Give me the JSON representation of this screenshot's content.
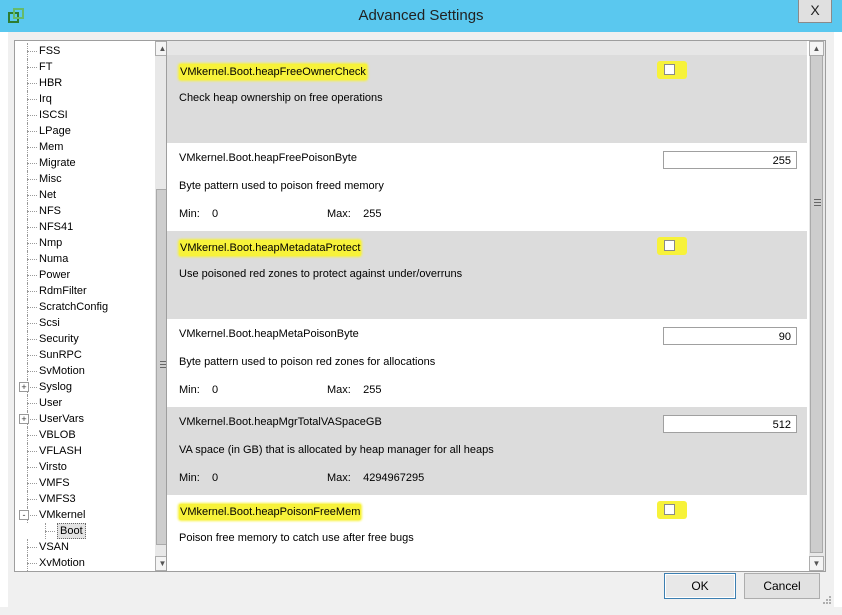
{
  "window": {
    "title": "Advanced Settings",
    "close_glyph": "X",
    "app_icon": "vsphere-logo-icon"
  },
  "tree": {
    "items": [
      {
        "label": "FSS"
      },
      {
        "label": "FT"
      },
      {
        "label": "HBR"
      },
      {
        "label": "Irq"
      },
      {
        "label": "ISCSI"
      },
      {
        "label": "LPage"
      },
      {
        "label": "Mem"
      },
      {
        "label": "Migrate"
      },
      {
        "label": "Misc"
      },
      {
        "label": "Net"
      },
      {
        "label": "NFS"
      },
      {
        "label": "NFS41"
      },
      {
        "label": "Nmp"
      },
      {
        "label": "Numa"
      },
      {
        "label": "Power"
      },
      {
        "label": "RdmFilter"
      },
      {
        "label": "ScratchConfig"
      },
      {
        "label": "Scsi"
      },
      {
        "label": "Security"
      },
      {
        "label": "SunRPC"
      },
      {
        "label": "SvMotion"
      },
      {
        "label": "Syslog",
        "expander": "+"
      },
      {
        "label": "User"
      },
      {
        "label": "UserVars",
        "expander": "+"
      },
      {
        "label": "VBLOB"
      },
      {
        "label": "VFLASH"
      },
      {
        "label": "Virsto"
      },
      {
        "label": "VMFS"
      },
      {
        "label": "VMFS3"
      },
      {
        "label": "VMkernel",
        "expander": "-"
      },
      {
        "label": "Boot",
        "child": true,
        "selected": true
      },
      {
        "label": "VSAN"
      },
      {
        "label": "XvMotion"
      }
    ]
  },
  "settings": [
    {
      "name": "VMkernel.Boot.heapFreeOwnerCheck",
      "highlighted": true,
      "description": "Check heap ownership on free operations",
      "type": "checkbox",
      "checked": false
    },
    {
      "name": "VMkernel.Boot.heapFreePoisonByte",
      "description": "Byte pattern used to poison freed memory",
      "type": "number",
      "value": "255",
      "min_label": "Min:",
      "min": "0",
      "max_label": "Max:",
      "max": "255"
    },
    {
      "name": "VMkernel.Boot.heapMetadataProtect",
      "highlighted": true,
      "description": "Use poisoned red zones to protect against under/overruns",
      "type": "checkbox",
      "checked": false
    },
    {
      "name": "VMkernel.Boot.heapMetaPoisonByte",
      "description": "Byte pattern used to poison red zones for allocations",
      "type": "number",
      "value": "90",
      "min_label": "Min:",
      "min": "0",
      "max_label": "Max:",
      "max": "255"
    },
    {
      "name": "VMkernel.Boot.heapMgrTotalVASpaceGB",
      "description": "VA space (in GB) that is allocated by heap manager for all heaps",
      "type": "number",
      "value": "512",
      "min_label": "Min:",
      "min": "0",
      "max_label": "Max:",
      "max": "4294967295"
    },
    {
      "name": "VMkernel.Boot.heapPoisonFreeMem",
      "highlighted": true,
      "description": "Poison free memory to catch use after free bugs",
      "type": "checkbox",
      "checked": false
    }
  ],
  "buttons": {
    "ok": "OK",
    "cancel": "Cancel"
  },
  "scroll_glyphs": {
    "up": "▲",
    "down": "▼"
  },
  "colors": {
    "titlebar": "#5ac8ef",
    "highlight": "#f7f23a"
  }
}
